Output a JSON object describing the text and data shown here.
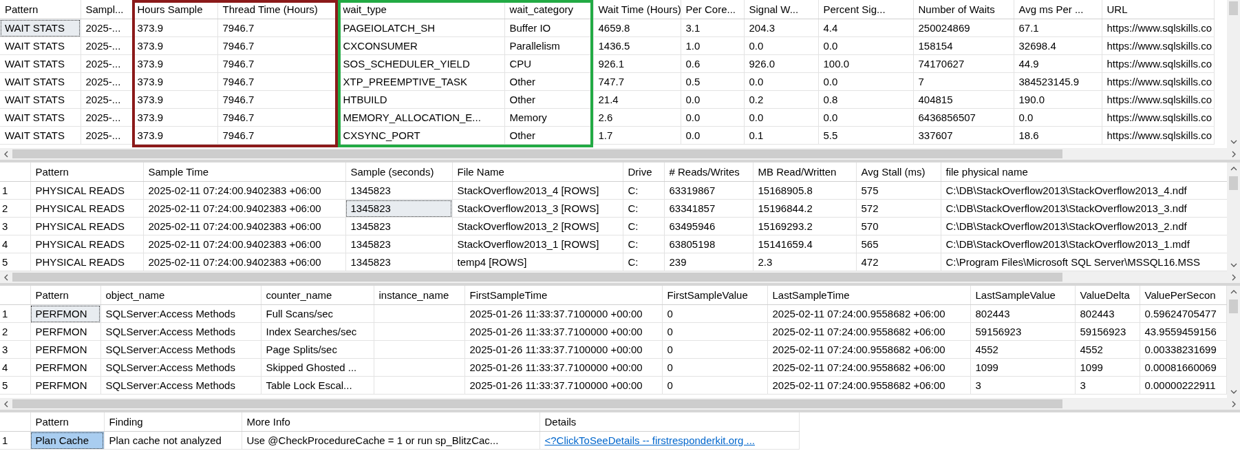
{
  "grids": [
    {
      "active": false,
      "row_numbers": false,
      "columns": [
        {
          "label": "Pattern",
          "kind": "text"
        },
        {
          "label": "Sampl...",
          "kind": "text"
        },
        {
          "label": "Hours Sample",
          "kind": "text",
          "color": "#8b1a1a"
        },
        {
          "label": "Thread Time (Hours)",
          "kind": "text",
          "color": "#8b1a1a"
        },
        {
          "label": "wait_type",
          "kind": "text",
          "color": "#22aa44"
        },
        {
          "label": "wait_category",
          "kind": "text",
          "color": "#22aa44"
        },
        {
          "label": "Wait Time (Hours)",
          "kind": "text"
        },
        {
          "label": "Per Core...",
          "kind": "text"
        },
        {
          "label": "Signal W...",
          "kind": "text"
        },
        {
          "label": "Percent Sig...",
          "kind": "text"
        },
        {
          "label": "Number of Waits",
          "kind": "text"
        },
        {
          "label": "Avg ms Per ...",
          "kind": "text"
        },
        {
          "label": "URL",
          "kind": "text"
        }
      ],
      "rows": [
        {
          "cells": [
            {
              "text": "WAIT STATS",
              "selected": true
            },
            {
              "text": "2025-...",
              "selected": false
            },
            {
              "text": "373.9",
              "selected": false
            },
            {
              "text": "7946.7",
              "selected": false
            },
            {
              "text": "PAGEIOLATCH_SH",
              "selected": false
            },
            {
              "text": "Buffer IO",
              "selected": false
            },
            {
              "text": "4659.8",
              "selected": false
            },
            {
              "text": "3.1",
              "selected": false
            },
            {
              "text": "204.3",
              "selected": false
            },
            {
              "text": "4.4",
              "selected": false
            },
            {
              "text": "250024869",
              "selected": false
            },
            {
              "text": "67.1",
              "selected": false
            },
            {
              "text": "https://www.sqlskills.co",
              "selected": false
            }
          ]
        },
        {
          "cells": [
            {
              "text": "WAIT STATS",
              "selected": false
            },
            {
              "text": "2025-...",
              "selected": false
            },
            {
              "text": "373.9",
              "selected": false
            },
            {
              "text": "7946.7",
              "selected": false
            },
            {
              "text": "CXCONSUMER",
              "selected": false
            },
            {
              "text": "Parallelism",
              "selected": false
            },
            {
              "text": "1436.5",
              "selected": false
            },
            {
              "text": "1.0",
              "selected": false
            },
            {
              "text": "0.0",
              "selected": false
            },
            {
              "text": "0.0",
              "selected": false
            },
            {
              "text": "158154",
              "selected": false
            },
            {
              "text": "32698.4",
              "selected": false
            },
            {
              "text": "https://www.sqlskills.co",
              "selected": false
            }
          ]
        },
        {
          "cells": [
            {
              "text": "WAIT STATS",
              "selected": false
            },
            {
              "text": "2025-...",
              "selected": false
            },
            {
              "text": "373.9",
              "selected": false
            },
            {
              "text": "7946.7",
              "selected": false
            },
            {
              "text": "SOS_SCHEDULER_YIELD",
              "selected": false
            },
            {
              "text": "CPU",
              "selected": false
            },
            {
              "text": "926.1",
              "selected": false
            },
            {
              "text": "0.6",
              "selected": false
            },
            {
              "text": "926.0",
              "selected": false
            },
            {
              "text": "100.0",
              "selected": false
            },
            {
              "text": "74170627",
              "selected": false
            },
            {
              "text": "44.9",
              "selected": false
            },
            {
              "text": "https://www.sqlskills.co",
              "selected": false
            }
          ]
        },
        {
          "cells": [
            {
              "text": "WAIT STATS",
              "selected": false
            },
            {
              "text": "2025-...",
              "selected": false
            },
            {
              "text": "373.9",
              "selected": false
            },
            {
              "text": "7946.7",
              "selected": false
            },
            {
              "text": "XTP_PREEMPTIVE_TASK",
              "selected": false
            },
            {
              "text": "Other",
              "selected": false
            },
            {
              "text": "747.7",
              "selected": false
            },
            {
              "text": "0.5",
              "selected": false
            },
            {
              "text": "0.0",
              "selected": false
            },
            {
              "text": "0.0",
              "selected": false
            },
            {
              "text": "7",
              "selected": false
            },
            {
              "text": "384523145.9",
              "selected": false
            },
            {
              "text": "https://www.sqlskills.co",
              "selected": false
            }
          ]
        },
        {
          "cells": [
            {
              "text": "WAIT STATS",
              "selected": false
            },
            {
              "text": "2025-...",
              "selected": false
            },
            {
              "text": "373.9",
              "selected": false
            },
            {
              "text": "7946.7",
              "selected": false
            },
            {
              "text": "HTBUILD",
              "selected": false
            },
            {
              "text": "Other",
              "selected": false
            },
            {
              "text": "21.4",
              "selected": false
            },
            {
              "text": "0.0",
              "selected": false
            },
            {
              "text": "0.2",
              "selected": false
            },
            {
              "text": "0.8",
              "selected": false
            },
            {
              "text": "404815",
              "selected": false
            },
            {
              "text": "190.0",
              "selected": false
            },
            {
              "text": "https://www.sqlskills.co",
              "selected": false
            }
          ]
        },
        {
          "cells": [
            {
              "text": "WAIT STATS",
              "selected": false
            },
            {
              "text": "2025-...",
              "selected": false
            },
            {
              "text": "373.9",
              "selected": false
            },
            {
              "text": "7946.7",
              "selected": false
            },
            {
              "text": "MEMORY_ALLOCATION_E...",
              "selected": false
            },
            {
              "text": "Memory",
              "selected": false
            },
            {
              "text": "2.6",
              "selected": false
            },
            {
              "text": "0.0",
              "selected": false
            },
            {
              "text": "0.0",
              "selected": false
            },
            {
              "text": "0.0",
              "selected": false
            },
            {
              "text": "6436856507",
              "selected": false
            },
            {
              "text": "0.0",
              "selected": false
            },
            {
              "text": "https://www.sqlskills.co",
              "selected": false
            }
          ]
        },
        {
          "cells": [
            {
              "text": "WAIT STATS",
              "selected": false
            },
            {
              "text": "2025-...",
              "selected": false
            },
            {
              "text": "373.9",
              "selected": false
            },
            {
              "text": "7946.7",
              "selected": false
            },
            {
              "text": "CXSYNC_PORT",
              "selected": false
            },
            {
              "text": "Other",
              "selected": false
            },
            {
              "text": "1.7",
              "selected": false
            },
            {
              "text": "0.0",
              "selected": false
            },
            {
              "text": "0.1",
              "selected": false
            },
            {
              "text": "5.5",
              "selected": false
            },
            {
              "text": "337607",
              "selected": false
            },
            {
              "text": "18.6",
              "selected": false
            },
            {
              "text": "https://www.sqlskills.co",
              "selected": false
            }
          ]
        }
      ]
    },
    {
      "active": false,
      "row_numbers": true,
      "columns": [
        {
          "label": "Pattern",
          "kind": "text"
        },
        {
          "label": "Sample Time",
          "kind": "text"
        },
        {
          "label": "Sample (seconds)",
          "kind": "text"
        },
        {
          "label": "File Name",
          "kind": "text"
        },
        {
          "label": "Drive",
          "kind": "text"
        },
        {
          "label": "# Reads/Writes",
          "kind": "text"
        },
        {
          "label": "MB Read/Written",
          "kind": "text"
        },
        {
          "label": "Avg Stall (ms)",
          "kind": "text"
        },
        {
          "label": "file physical name",
          "kind": "text"
        }
      ],
      "rows": [
        {
          "number": "1",
          "cells": [
            {
              "text": "PHYSICAL READS",
              "selected": false
            },
            {
              "text": "2025-02-11 07:24:00.9402383 +06:00",
              "selected": false
            },
            {
              "text": "1345823",
              "selected": false
            },
            {
              "text": "StackOverflow2013_4 [ROWS]",
              "selected": false
            },
            {
              "text": "C:",
              "selected": false
            },
            {
              "text": "63319867",
              "selected": false
            },
            {
              "text": "15168905.8",
              "selected": false
            },
            {
              "text": "575",
              "selected": false
            },
            {
              "text": "C:\\DB\\StackOverflow2013\\StackOverflow2013_4.ndf",
              "selected": false
            }
          ]
        },
        {
          "number": "2",
          "cells": [
            {
              "text": "PHYSICAL READS",
              "selected": false
            },
            {
              "text": "2025-02-11 07:24:00.9402383 +06:00",
              "selected": false
            },
            {
              "text": "1345823",
              "selected": true
            },
            {
              "text": "StackOverflow2013_3 [ROWS]",
              "selected": false
            },
            {
              "text": "C:",
              "selected": false
            },
            {
              "text": "63341857",
              "selected": false
            },
            {
              "text": "15196844.2",
              "selected": false
            },
            {
              "text": "572",
              "selected": false
            },
            {
              "text": "C:\\DB\\StackOverflow2013\\StackOverflow2013_3.ndf",
              "selected": false
            }
          ]
        },
        {
          "number": "3",
          "cells": [
            {
              "text": "PHYSICAL READS",
              "selected": false
            },
            {
              "text": "2025-02-11 07:24:00.9402383 +06:00",
              "selected": false
            },
            {
              "text": "1345823",
              "selected": false
            },
            {
              "text": "StackOverflow2013_2 [ROWS]",
              "selected": false
            },
            {
              "text": "C:",
              "selected": false
            },
            {
              "text": "63495946",
              "selected": false
            },
            {
              "text": "15169293.2",
              "selected": false
            },
            {
              "text": "570",
              "selected": false
            },
            {
              "text": "C:\\DB\\StackOverflow2013\\StackOverflow2013_2.ndf",
              "selected": false
            }
          ]
        },
        {
          "number": "4",
          "cells": [
            {
              "text": "PHYSICAL READS",
              "selected": false
            },
            {
              "text": "2025-02-11 07:24:00.9402383 +06:00",
              "selected": false
            },
            {
              "text": "1345823",
              "selected": false
            },
            {
              "text": "StackOverflow2013_1 [ROWS]",
              "selected": false
            },
            {
              "text": "C:",
              "selected": false
            },
            {
              "text": "63805198",
              "selected": false
            },
            {
              "text": "15141659.4",
              "selected": false
            },
            {
              "text": "565",
              "selected": false
            },
            {
              "text": "C:\\DB\\StackOverflow2013\\StackOverflow2013_1.mdf",
              "selected": false
            }
          ]
        },
        {
          "number": "5",
          "cells": [
            {
              "text": "PHYSICAL READS",
              "selected": false
            },
            {
              "text": "2025-02-11 07:24:00.9402383 +06:00",
              "selected": false
            },
            {
              "text": "1345823",
              "selected": false
            },
            {
              "text": "temp4 [ROWS]",
              "selected": false
            },
            {
              "text": "C:",
              "selected": false
            },
            {
              "text": "239",
              "selected": false
            },
            {
              "text": "2.3",
              "selected": false
            },
            {
              "text": "472",
              "selected": false
            },
            {
              "text": "C:\\Program Files\\Microsoft SQL Server\\MSSQL16.MSS",
              "selected": false
            }
          ]
        }
      ]
    },
    {
      "active": false,
      "row_numbers": true,
      "columns": [
        {
          "label": "Pattern",
          "kind": "text"
        },
        {
          "label": "object_name",
          "kind": "text"
        },
        {
          "label": "counter_name",
          "kind": "text"
        },
        {
          "label": "instance_name",
          "kind": "text"
        },
        {
          "label": "FirstSampleTime",
          "kind": "text"
        },
        {
          "label": "FirstSampleValue",
          "kind": "text"
        },
        {
          "label": "LastSampleTime",
          "kind": "text"
        },
        {
          "label": "LastSampleValue",
          "kind": "text"
        },
        {
          "label": "ValueDelta",
          "kind": "text"
        },
        {
          "label": "ValuePerSecon",
          "kind": "text"
        }
      ],
      "rows": [
        {
          "number": "1",
          "cells": [
            {
              "text": "PERFMON",
              "selected": true
            },
            {
              "text": "SQLServer:Access Methods",
              "selected": false
            },
            {
              "text": "Full Scans/sec",
              "selected": false
            },
            {
              "selected": false
            },
            {
              "text": "2025-01-26 11:33:37.7100000 +00:00",
              "selected": false
            },
            {
              "text": "0",
              "selected": false
            },
            {
              "text": "2025-02-11 07:24:00.9558682 +06:00",
              "selected": false
            },
            {
              "text": "802443",
              "selected": false
            },
            {
              "text": "802443",
              "selected": false
            },
            {
              "text": "0.59624705477",
              "selected": false
            }
          ]
        },
        {
          "number": "2",
          "cells": [
            {
              "text": "PERFMON",
              "selected": false
            },
            {
              "text": "SQLServer:Access Methods",
              "selected": false
            },
            {
              "text": "Index Searches/sec",
              "selected": false
            },
            {
              "selected": false
            },
            {
              "text": "2025-01-26 11:33:37.7100000 +00:00",
              "selected": false
            },
            {
              "text": "0",
              "selected": false
            },
            {
              "text": "2025-02-11 07:24:00.9558682 +06:00",
              "selected": false
            },
            {
              "text": "59156923",
              "selected": false
            },
            {
              "text": "59156923",
              "selected": false
            },
            {
              "text": "43.9559459156",
              "selected": false
            }
          ]
        },
        {
          "number": "3",
          "cells": [
            {
              "text": "PERFMON",
              "selected": false
            },
            {
              "text": "SQLServer:Access Methods",
              "selected": false
            },
            {
              "text": "Page Splits/sec",
              "selected": false
            },
            {
              "selected": false
            },
            {
              "text": "2025-01-26 11:33:37.7100000 +00:00",
              "selected": false
            },
            {
              "text": "0",
              "selected": false
            },
            {
              "text": "2025-02-11 07:24:00.9558682 +06:00",
              "selected": false
            },
            {
              "text": "4552",
              "selected": false
            },
            {
              "text": "4552",
              "selected": false
            },
            {
              "text": "0.00338231699",
              "selected": false
            }
          ]
        },
        {
          "number": "4",
          "cells": [
            {
              "text": "PERFMON",
              "selected": false
            },
            {
              "text": "SQLServer:Access Methods",
              "selected": false
            },
            {
              "text": "Skipped Ghosted ...",
              "selected": false
            },
            {
              "selected": false
            },
            {
              "text": "2025-01-26 11:33:37.7100000 +00:00",
              "selected": false
            },
            {
              "text": "0",
              "selected": false
            },
            {
              "text": "2025-02-11 07:24:00.9558682 +06:00",
              "selected": false
            },
            {
              "text": "1099",
              "selected": false
            },
            {
              "text": "1099",
              "selected": false
            },
            {
              "text": "0.00081660069",
              "selected": false
            }
          ]
        },
        {
          "number": "5",
          "cells": [
            {
              "text": "PERFMON",
              "selected": false
            },
            {
              "text": "SQLServer:Access Methods",
              "selected": false
            },
            {
              "text": "Table Lock Escal...",
              "selected": false
            },
            {
              "selected": false
            },
            {
              "text": "2025-01-26 11:33:37.7100000 +00:00",
              "selected": false
            },
            {
              "text": "0",
              "selected": false
            },
            {
              "text": "2025-02-11 07:24:00.9558682 +06:00",
              "selected": false
            },
            {
              "text": "3",
              "selected": false
            },
            {
              "text": "3",
              "selected": false
            },
            {
              "text": "0.00000222911",
              "selected": false
            }
          ]
        }
      ]
    },
    {
      "active": true,
      "row_numbers": true,
      "columns": [
        {
          "label": "Pattern",
          "kind": "text"
        },
        {
          "label": "Finding",
          "kind": "text"
        },
        {
          "label": "More Info",
          "kind": "text"
        },
        {
          "label": "Details",
          "kind": "link"
        }
      ],
      "rows": [
        {
          "number": "1",
          "cells": [
            {
              "text": "Plan Cache",
              "selected": true
            },
            {
              "text": "Plan cache not analyzed",
              "selected": false
            },
            {
              "text": "Use @CheckProcedureCache = 1 or run sp_BlitzCac...",
              "selected": false
            },
            {
              "text": "<?ClickToSeeDetails --    firstresponderkit.org  ...",
              "selected": false
            }
          ]
        }
      ]
    }
  ]
}
